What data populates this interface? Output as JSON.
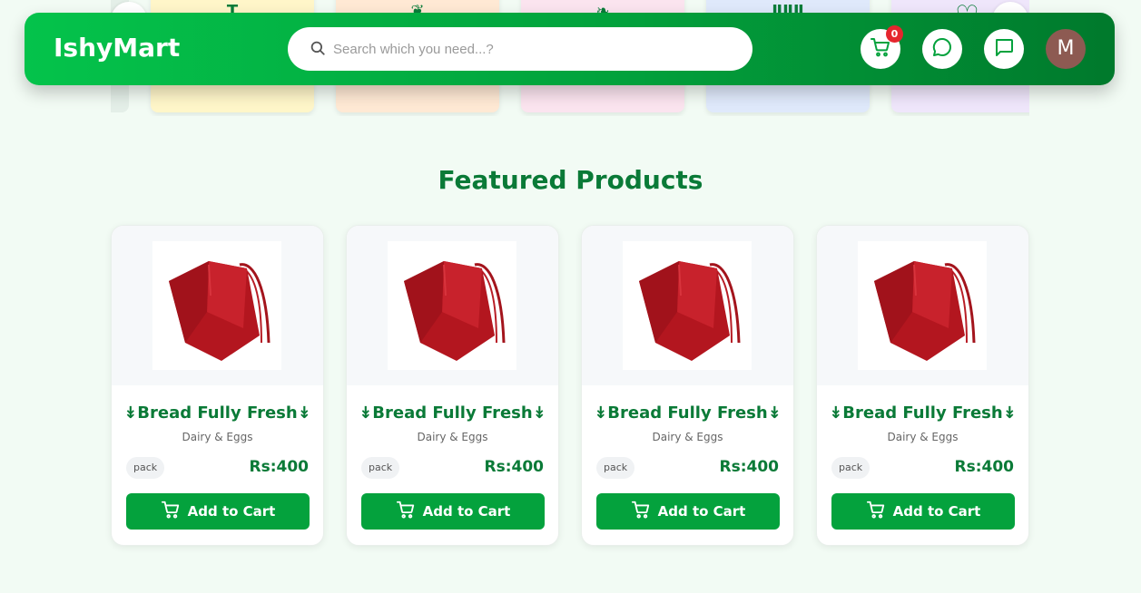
{
  "header": {
    "logo": "IshyMart",
    "search": {
      "placeholder": "Search which you need...?"
    },
    "cart": {
      "icon": "cart-icon",
      "count": "0"
    },
    "chat_icon": "chat-bubble-icon",
    "message_icon": "message-square-icon",
    "avatar_letter": "M"
  },
  "categories": [
    {
      "glyph": "T",
      "color": "#fff6c9"
    },
    {
      "glyph": "❦",
      "color": "#ffe9d4"
    },
    {
      "glyph": "❧",
      "color": "#fbe4ef"
    },
    {
      "glyph": "ⅡⅡⅡ",
      "color": "#dfe9fb"
    },
    {
      "glyph": "",
      "color": "#efe6fb"
    }
  ],
  "featured": {
    "title": "Featured Products",
    "products": [
      {
        "name": "↡Bread Fully Fresh↡",
        "category": "Dairy & Eggs",
        "unit": "pack",
        "price": "Rs:400",
        "button": "Add to Cart"
      },
      {
        "name": "↡Bread Fully Fresh↡",
        "category": "Dairy & Eggs",
        "unit": "pack",
        "price": "Rs:400",
        "button": "Add to Cart"
      },
      {
        "name": "↡Bread Fully Fresh↡",
        "category": "Dairy & Eggs",
        "unit": "pack",
        "price": "Rs:400",
        "button": "Add to Cart"
      },
      {
        "name": "↡Bread Fully Fresh↡",
        "category": "Dairy & Eggs",
        "unit": "pack",
        "price": "Rs:400",
        "button": "Add to Cart"
      }
    ]
  },
  "colors": {
    "brand": "#04c34b",
    "brand_dark": "#00792c",
    "title_green": "#0a7a37",
    "button": "#04a23d",
    "badge": "#e5262e"
  }
}
